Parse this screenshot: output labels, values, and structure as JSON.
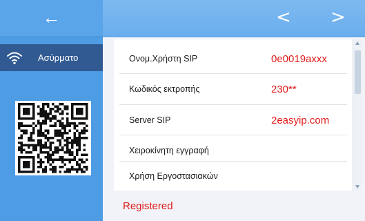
{
  "header": {
    "back_icon": "arrow-left-icon",
    "prev_icon": "chevron-left-icon",
    "next_icon": "chevron-right-icon",
    "back_glyph": "←",
    "prev_glyph": "<",
    "next_glyph": ">"
  },
  "sidebar": {
    "items": [
      {
        "label": "Ασύρματο",
        "icon": "wifi-icon"
      }
    ],
    "qr_icon": "qr-code-icon"
  },
  "settings": [
    {
      "label": "Ονομ.Χρήστη SIP",
      "value": "0e0019axxx"
    },
    {
      "label": "Κωδικός εκτροπής",
      "value": "230**"
    },
    {
      "label": "Server  SIP",
      "value": "2easyip.com"
    },
    {
      "label": "Χειροκίνητη εγγραφή",
      "value": ""
    },
    {
      "label": "Χρήση Εργοστασιακών",
      "value": ""
    }
  ],
  "status": "Registered",
  "colors": {
    "sidebar": "#4d9ce4",
    "sidebar_selected": "#315a92",
    "topbar": "#6aaeee",
    "value_text": "#e11a1a"
  }
}
